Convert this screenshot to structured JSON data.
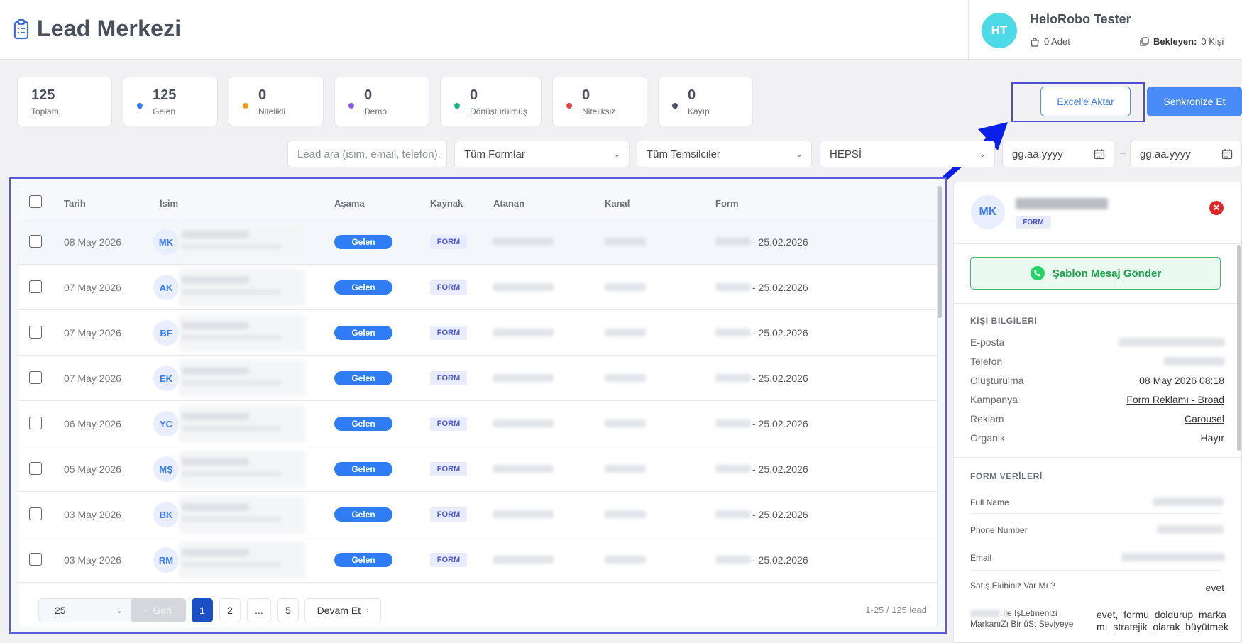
{
  "header": {
    "title": "Lead Merkezi",
    "user": {
      "initials": "HT",
      "name": "HeloRobo Tester",
      "adet": "0 Adet",
      "bekleyen_label": "Bekleyen:",
      "bekleyen_value": "0 Kişi"
    }
  },
  "stats": [
    {
      "value": "125",
      "label": "Toplam",
      "dot": null
    },
    {
      "value": "125",
      "label": "Gelen",
      "dot": "#3b7df0"
    },
    {
      "value": "0",
      "label": "Nitelikli",
      "dot": "#f59e0b"
    },
    {
      "value": "0",
      "label": "Demo",
      "dot": "#8b5cf6"
    },
    {
      "value": "0",
      "label": "Dönüştürülmüş",
      "dot": "#10b981"
    },
    {
      "value": "0",
      "label": "Niteliksiz",
      "dot": "#ef4444"
    },
    {
      "value": "0",
      "label": "Kayıp",
      "dot": "#4b5563"
    }
  ],
  "actions": {
    "excel": "Excel'e Aktar",
    "sync": "Senkronize Et"
  },
  "filters": {
    "search_placeholder": "Lead ara (isim, email, telefon).",
    "forms": "Tüm Formlar",
    "reps": "Tüm Temsilciler",
    "stage": "HEPSİ",
    "date_from": "gg.aa.yyyy",
    "date_sep": "–",
    "date_to": "gg.aa.yyyy"
  },
  "table": {
    "columns": [
      "Tarih",
      "İsim",
      "Aşama",
      "Kaynak",
      "Atanan",
      "Kanal",
      "Form"
    ],
    "rows": [
      {
        "date": "08 May 2026",
        "initials": "MK",
        "stage": "Gelen",
        "source": "FORM",
        "form_date": "- 25.02.2026"
      },
      {
        "date": "07 May 2026",
        "initials": "AK",
        "stage": "Gelen",
        "source": "FORM",
        "form_date": "- 25.02.2026"
      },
      {
        "date": "07 May 2026",
        "initials": "BF",
        "stage": "Gelen",
        "source": "FORM",
        "form_date": "- 25.02.2026"
      },
      {
        "date": "07 May 2026",
        "initials": "EK",
        "stage": "Gelen",
        "source": "FORM",
        "form_date": "- 25.02.2026"
      },
      {
        "date": "06 May 2026",
        "initials": "YC",
        "stage": "Gelen",
        "source": "FORM",
        "form_date": "- 25.02.2026"
      },
      {
        "date": "05 May 2026",
        "initials": "MŞ",
        "stage": "Gelen",
        "source": "FORM",
        "form_date": "- 25.02.2026"
      },
      {
        "date": "03 May 2026",
        "initials": "BK",
        "stage": "Gelen",
        "source": "FORM",
        "form_date": "- 25.02.2026"
      },
      {
        "date": "03 May 2026",
        "initials": "RM",
        "stage": "Gelen",
        "source": "FORM",
        "form_date": "- 25.02.2026"
      }
    ]
  },
  "pagination": {
    "per_page": "25",
    "prev": "Geri",
    "pages": [
      "1",
      "2",
      "...",
      "5"
    ],
    "active_page": "1",
    "next": "Devam Et",
    "info": "1-25 / 125 lead"
  },
  "detail": {
    "initials": "MK",
    "badge": "FORM",
    "whatsapp_button": "Şablon Mesaj Gönder",
    "person_section": "KİŞİ BİLGİLERİ",
    "person": [
      {
        "key": "E-posta",
        "value": ""
      },
      {
        "key": "Telefon",
        "value": ""
      },
      {
        "key": "Oluşturulma",
        "value": "08 May 2026 08:18"
      },
      {
        "key": "Kampanya",
        "value": "Form Reklamı - Broad"
      },
      {
        "key": "Reklam",
        "value": "Carousel"
      },
      {
        "key": "Organik",
        "value": "Hayır"
      }
    ],
    "form_section": "FORM VERİLERİ",
    "form_fields": [
      {
        "key": "Full Name",
        "value": ""
      },
      {
        "key": "Phone Number",
        "value": ""
      },
      {
        "key": "Email",
        "value": ""
      },
      {
        "key": "Satış Ekibiniz Var Mı ?",
        "value": "evet"
      },
      {
        "key": "İle IşLetmenizi MarkanıZı Bir üSt Seviyeye",
        "value": "evet,_formu_doldurup_marka mı_stratejik_olarak_büyütmek"
      }
    ]
  }
}
